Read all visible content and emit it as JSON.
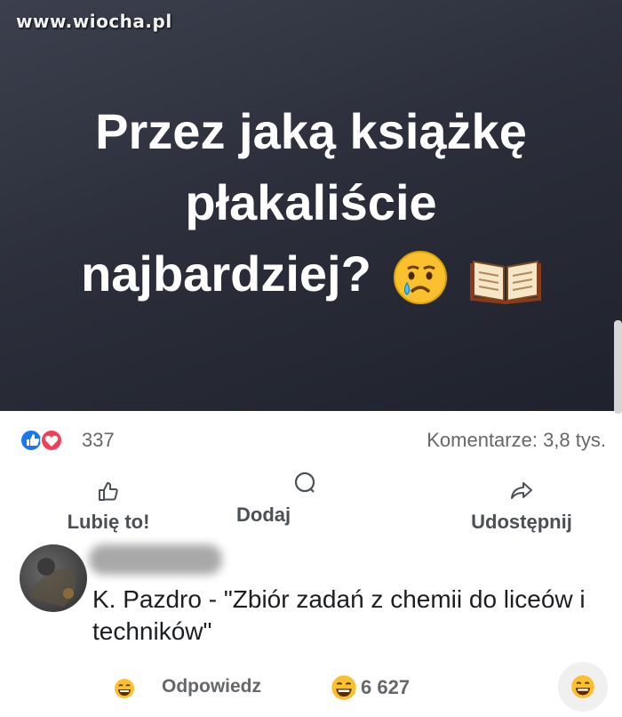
{
  "watermark": "www.wiocha.pl",
  "post": {
    "headline_lines": [
      "Przez jaką książkę",
      "płakaliście",
      "najbardziej?"
    ],
    "emojis": [
      "crying-face",
      "open-book"
    ]
  },
  "stats": {
    "reactions_count": "337",
    "comments_label": "Komentarze: 3,8 tys."
  },
  "actions": {
    "like": "Lubię to!",
    "comment": "Dodaj",
    "share": "Udostępnij"
  },
  "comment": {
    "text": "K. Pazdro - \"Zbiór zadań z chemii do liceów i techników\"",
    "reply_label": "Odpowiedz",
    "reaction_count": "6 627"
  },
  "colors": {
    "banner_bg": "#2c2f3b",
    "like_blue": "#1877f2",
    "love_red": "#f33e58",
    "text_gray": "#65676b"
  }
}
